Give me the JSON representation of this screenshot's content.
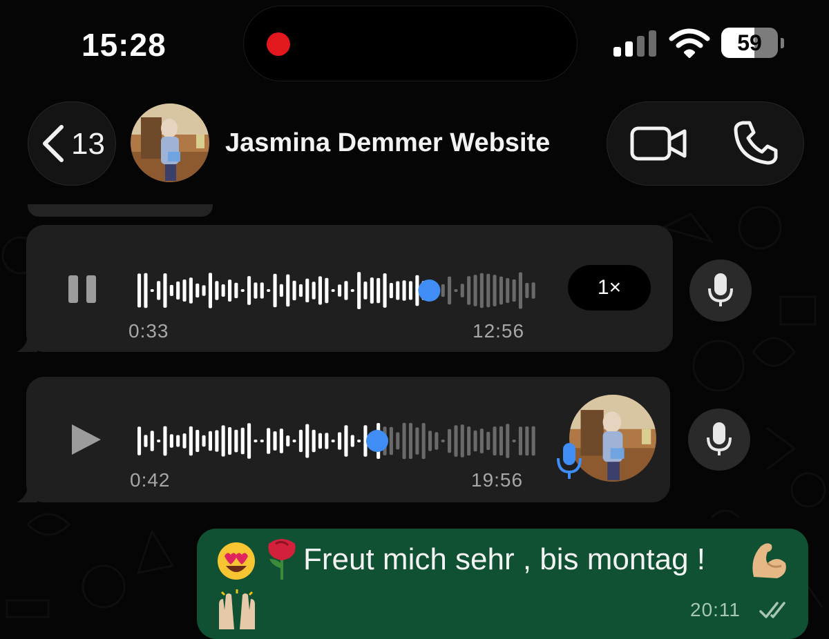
{
  "status_bar": {
    "time": "15:28",
    "battery_percent": "59",
    "battery_level": 0.59,
    "recording_indicator_color": "#e3181e",
    "icons": [
      "signal-bars-icon",
      "wifi-icon",
      "battery-icon"
    ]
  },
  "header": {
    "back_count": "13",
    "contact_name": "Jasmina Demmer Website",
    "icons": [
      "back-chevron-icon",
      "video-camera-icon",
      "phone-icon"
    ]
  },
  "messages": [
    {
      "type": "voice",
      "state": "playing",
      "elapsed": "0:33",
      "duration": "12:56",
      "playback_speed": "1×",
      "progress": 0.73,
      "icons": [
        "pause-icon",
        "microphone-icon"
      ]
    },
    {
      "type": "voice",
      "state": "paused",
      "elapsed": "0:42",
      "duration": "19:56",
      "progress": 0.6,
      "icons": [
        "play-icon",
        "microphone-icon"
      ]
    },
    {
      "type": "text",
      "direction": "outgoing",
      "text": "Freut mich sehr , bis montag !",
      "time": "20:11",
      "status": "read",
      "emojis": [
        "heart-eyes-emoji",
        "rose-emoji",
        "flexed-biceps-emoji",
        "raising-hands-emoji"
      ]
    }
  ],
  "colors": {
    "background": "#050505",
    "bubble_incoming": "#1f1f1f",
    "bubble_outgoing": "#0f5132",
    "waveform_played": "#ffffff",
    "waveform_unplayed": "#6a6a6a",
    "scrubber": "#3f8df5"
  }
}
